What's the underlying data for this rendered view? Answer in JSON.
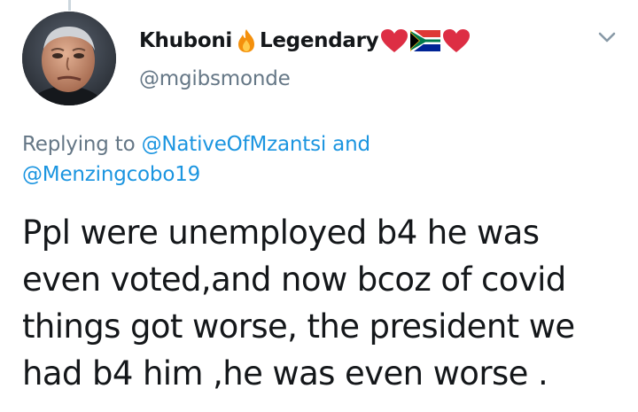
{
  "tweet": {
    "author": {
      "display_name": "Khuboni",
      "display_name_suffix": "Legendary",
      "name_emojis": [
        "fire-emoji",
        "red-heart-emoji",
        "south-africa-flag-emoji",
        "red-heart-emoji"
      ],
      "handle": "@mgibsmonde",
      "avatar": "avatar-photo"
    },
    "menu_icon": "chevron-down-icon",
    "replying": {
      "prefix": "Replying to",
      "mention_1": "@NativeOfMzantsi",
      "joiner": "and",
      "mention_2": "@Menzingcobo19"
    },
    "text": "Ppl were unemployed b4 he was\neven voted,and now bcoz of covid\nthings got worse, the president we\nhad b4 him ,he was even worse  ."
  },
  "colors": {
    "primary_text": "#14171a",
    "secondary_text": "#657786",
    "link": "#1b95e0",
    "heart": "#dd2e44",
    "fire": "#f4900c"
  }
}
